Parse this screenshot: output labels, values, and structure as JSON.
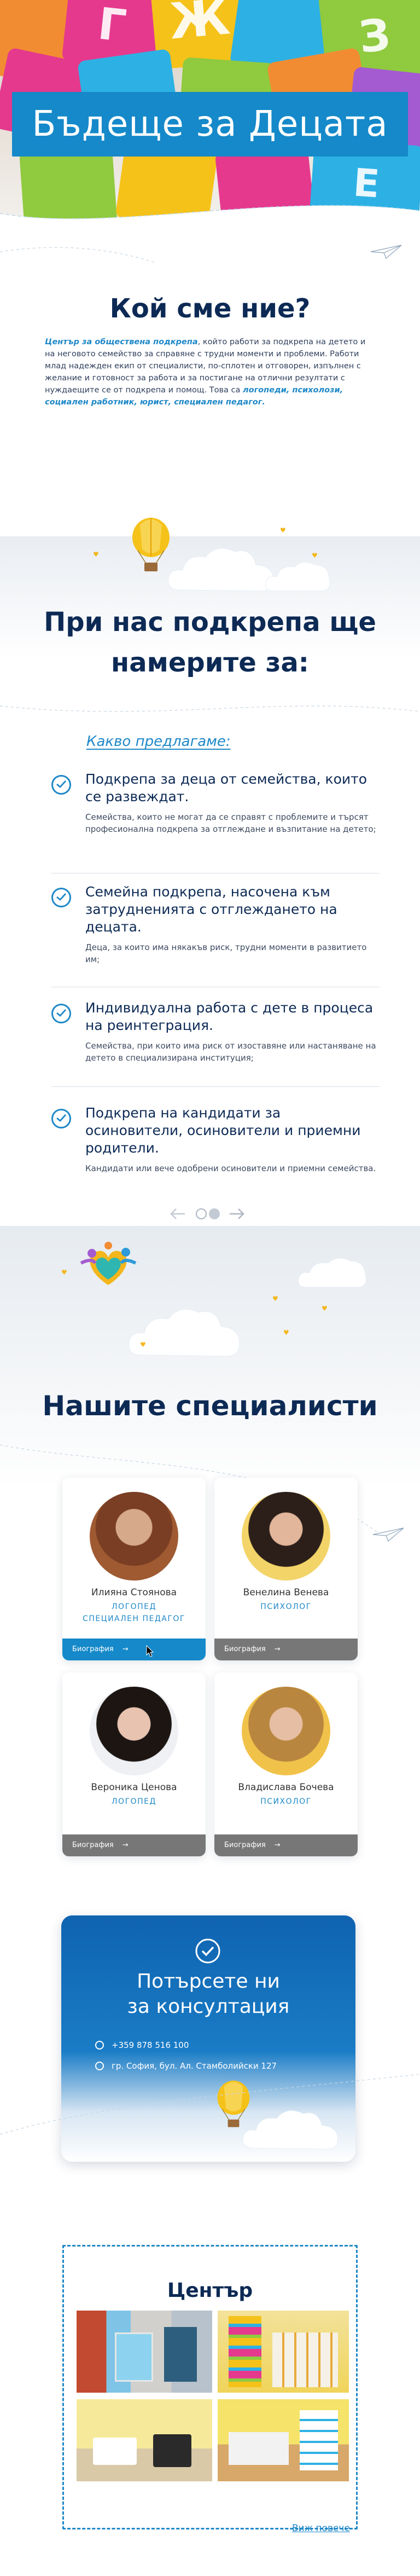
{
  "hero": {
    "title": "Бъдеще за Децата"
  },
  "about": {
    "title": "Кой сме ние?",
    "text_parts": [
      {
        "t": "Център за обществена подкрепа",
        "hl": true
      },
      {
        "t": ", който работи за подкрепа на детето и на неговото семейство за справяне с трудни моменти и проблеми. Работи млад надежден екип от специалисти, по-сплотен и отговорен, изпълнен с желание и готовност за работа и за постигане на отлични резултати с нуждаещите се от подкрепа и помощ. Това са ",
        "hl": false
      },
      {
        "t": "логопеди, психолози, социален работник, юрист, специален педагог.",
        "hl": true
      }
    ]
  },
  "offer": {
    "title": "При нас подкрепа ще намерите за:",
    "subtitle": "Какво предлагаме:",
    "items": [
      {
        "heading": "Подкрепа за деца от семейства, които се развеждат.",
        "text": "Семейства, които не могат да се справят с проблемите и търсят професионална подкрепа за отглеждане и възпитание на детето;"
      },
      {
        "heading": "Семейна подкрепа, насочена към затрудненията с отглеждането на децата.",
        "text": "Деца, за които има някакъв риск, трудни моменти в развитието им;"
      },
      {
        "heading": "Индивидуална работа с дете в процеса на реинтеграция.",
        "text": "Семейства, при които има риск от изоставяне или настаняване на детето в специализирана институция;"
      },
      {
        "heading": "Подкрепа на кандидати за осиновители, осиновители и приемни родители.",
        "text": "Кандидати или вече одобрени осиновители и приемни семейства."
      }
    ]
  },
  "specialists": {
    "title": "Нашите специалисти",
    "bio_label": "Биография",
    "cards": [
      {
        "name": "Илияна Стоянова",
        "roles": [
          "ЛОГОПЕД",
          "СПЕЦИАЛЕН ПЕДАГОГ"
        ]
      },
      {
        "name": "Венелина Венева",
        "roles": [
          "ПСИХОЛОГ"
        ]
      },
      {
        "name": "Вероника Ценова",
        "roles": [
          "ЛОГОПЕД"
        ]
      },
      {
        "name": "Владислава Бочева",
        "roles": [
          "ПСИХОЛОГ"
        ]
      }
    ]
  },
  "contact": {
    "title_line1": "Потърсете ни",
    "title_line2": "за консултация",
    "phone": "+359 878 516 100",
    "address": "гр. София, бул. Ал. Стамболийски 127"
  },
  "center": {
    "title": "Център",
    "see_more": "Виж повече"
  },
  "colors": {
    "primary": "#1589c9",
    "navy": "#0d2a55",
    "accent_yellow": "#f3b61b"
  }
}
